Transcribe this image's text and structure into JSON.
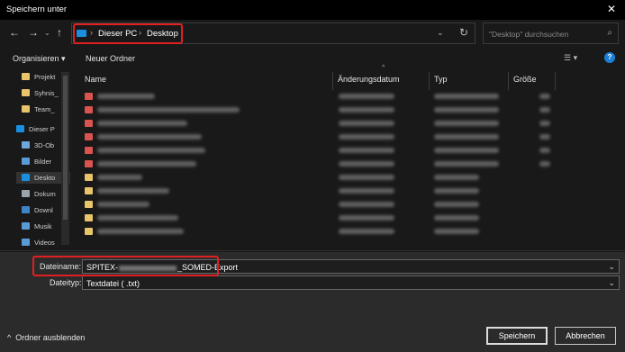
{
  "window": {
    "title": "Speichern unter",
    "close_glyph": "✕"
  },
  "nav": {
    "back_glyph": "←",
    "forward_glyph": "→",
    "up_glyph": "↑",
    "breadcrumb": [
      "Dieser PC",
      "Desktop"
    ],
    "search_placeholder": "\"Desktop\" durchsuchen"
  },
  "toolbar": {
    "organize": "Organisieren ▾",
    "new_folder": "Neuer Ordner",
    "help": "?"
  },
  "sidebar": {
    "items": [
      {
        "label": "Projekt",
        "icon": "folder-icon"
      },
      {
        "label": "Syhnis_",
        "icon": "folder-icon"
      },
      {
        "label": "Team_",
        "icon": "folder-icon"
      },
      {
        "label": "Dieser P",
        "icon": "computer-icon"
      },
      {
        "label": "3D-Ob",
        "icon": "cube-icon"
      },
      {
        "label": "Bilder",
        "icon": "pictures-icon"
      },
      {
        "label": "Deskto",
        "icon": "desktop-icon"
      },
      {
        "label": "Dokum",
        "icon": "documents-icon"
      },
      {
        "label": "Downl",
        "icon": "download-icon"
      },
      {
        "label": "Musik",
        "icon": "music-icon"
      },
      {
        "label": "Videos",
        "icon": "video-icon"
      }
    ]
  },
  "columns": {
    "name": "Name",
    "date": "Änderungsdatum",
    "type": "Typ",
    "size": "Größe"
  },
  "files": [
    {
      "kind": "shortcut"
    },
    {
      "kind": "shortcut"
    },
    {
      "kind": "shortcut"
    },
    {
      "kind": "shortcut"
    },
    {
      "kind": "shortcut"
    },
    {
      "kind": "shortcut"
    },
    {
      "kind": "folder"
    },
    {
      "kind": "folder"
    },
    {
      "kind": "folder"
    },
    {
      "kind": "folder"
    },
    {
      "kind": "folder"
    }
  ],
  "form": {
    "filename_label": "Dateiname:",
    "filename_prefix": "SPITEX-",
    "filename_suffix": "_SOMED-Export",
    "filetype_label": "Dateityp:",
    "filetype_value": "Textdatei  ( .txt)"
  },
  "footer": {
    "hide_folders": "Ordner ausblenden",
    "save": "Speichern",
    "cancel": "Abbrechen"
  },
  "colors": {
    "highlight": "#e02020",
    "accent": "#1a8fe0",
    "folder": "#e8c46a",
    "shortcut": "#d9534f"
  }
}
